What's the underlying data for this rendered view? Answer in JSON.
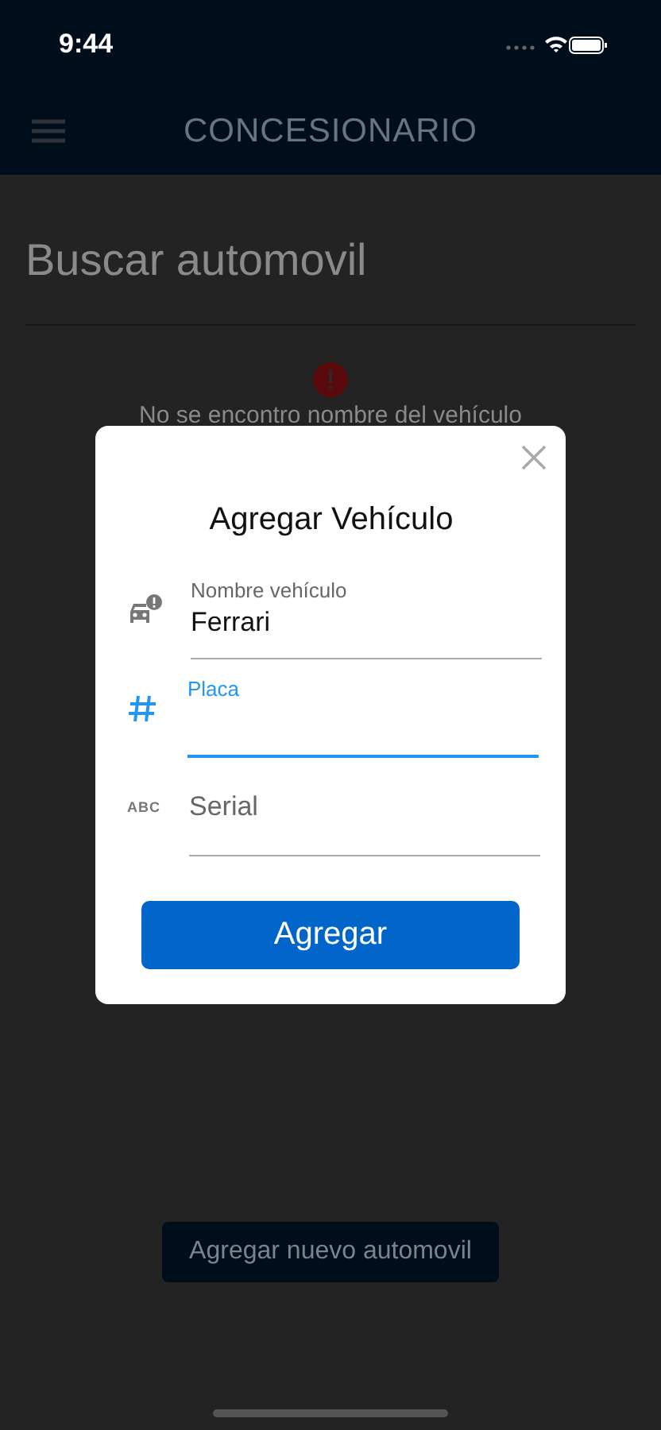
{
  "status_bar": {
    "time": "9:44"
  },
  "header": {
    "title": "CONCESIONARIO"
  },
  "page": {
    "title": "Buscar automovil",
    "error": "No se encontro nombre del vehículo",
    "button": "Agregar nuevo automovil"
  },
  "dialog": {
    "title": "Agregar Vehículo",
    "fields": [
      {
        "kind": "car",
        "label": "Nombre vehículo",
        "value": "Ferrari",
        "focused": false
      },
      {
        "kind": "number",
        "label": "Placa",
        "focused": true
      },
      {
        "kind": "text",
        "icon_text": "ABC",
        "placeholder": "Serial",
        "focused": false
      }
    ],
    "button": "Agregar"
  }
}
